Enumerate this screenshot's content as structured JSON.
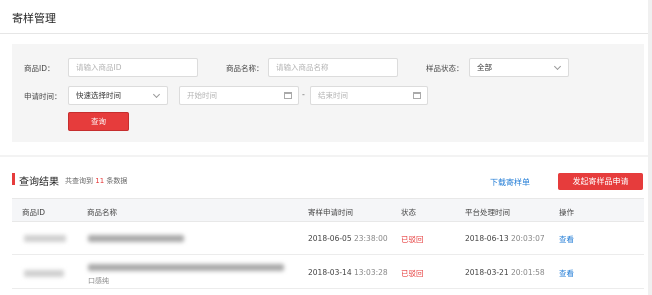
{
  "page": {
    "title": "寄样管理"
  },
  "filters": {
    "product_id_label": "商品ID：",
    "product_id_placeholder": "请输入商品ID",
    "product_name_label": "商品名称：",
    "product_name_placeholder": "请输入商品名称",
    "sample_status_label": "样品状态：",
    "sample_status_value": "全部",
    "apply_time_label": "申请时间：",
    "quick_time_value": "快速选择时间",
    "start_time_placeholder": "开始时间",
    "end_time_placeholder": "结束时间",
    "range_separator": "-",
    "query_label": "查询"
  },
  "results": {
    "title": "查询结果",
    "count_prefix": "共查询到",
    "count": "11",
    "count_suffix": "条数据",
    "download_label": "下载寄样单",
    "apply_button_label": "发起寄样品申请"
  },
  "table": {
    "columns": {
      "product_id": "商品ID",
      "product_name": "商品名称",
      "apply_time": "寄样申请时间",
      "status": "状态",
      "process_time": "平台处理时间",
      "action": "操作"
    },
    "rows": [
      {
        "apply_date": "2018-06-05",
        "apply_clock": "23:38:00",
        "status": "已驳回",
        "process_date": "2018-06-13",
        "process_clock": "20:03:07",
        "action": "查看"
      },
      {
        "apply_date": "2018-03-14",
        "apply_clock": "13:03:28",
        "status": "已驳回",
        "process_date": "2018-03-21",
        "process_clock": "20:01:58",
        "action": "查看",
        "name_fragment": "口感纯"
      }
    ]
  }
}
